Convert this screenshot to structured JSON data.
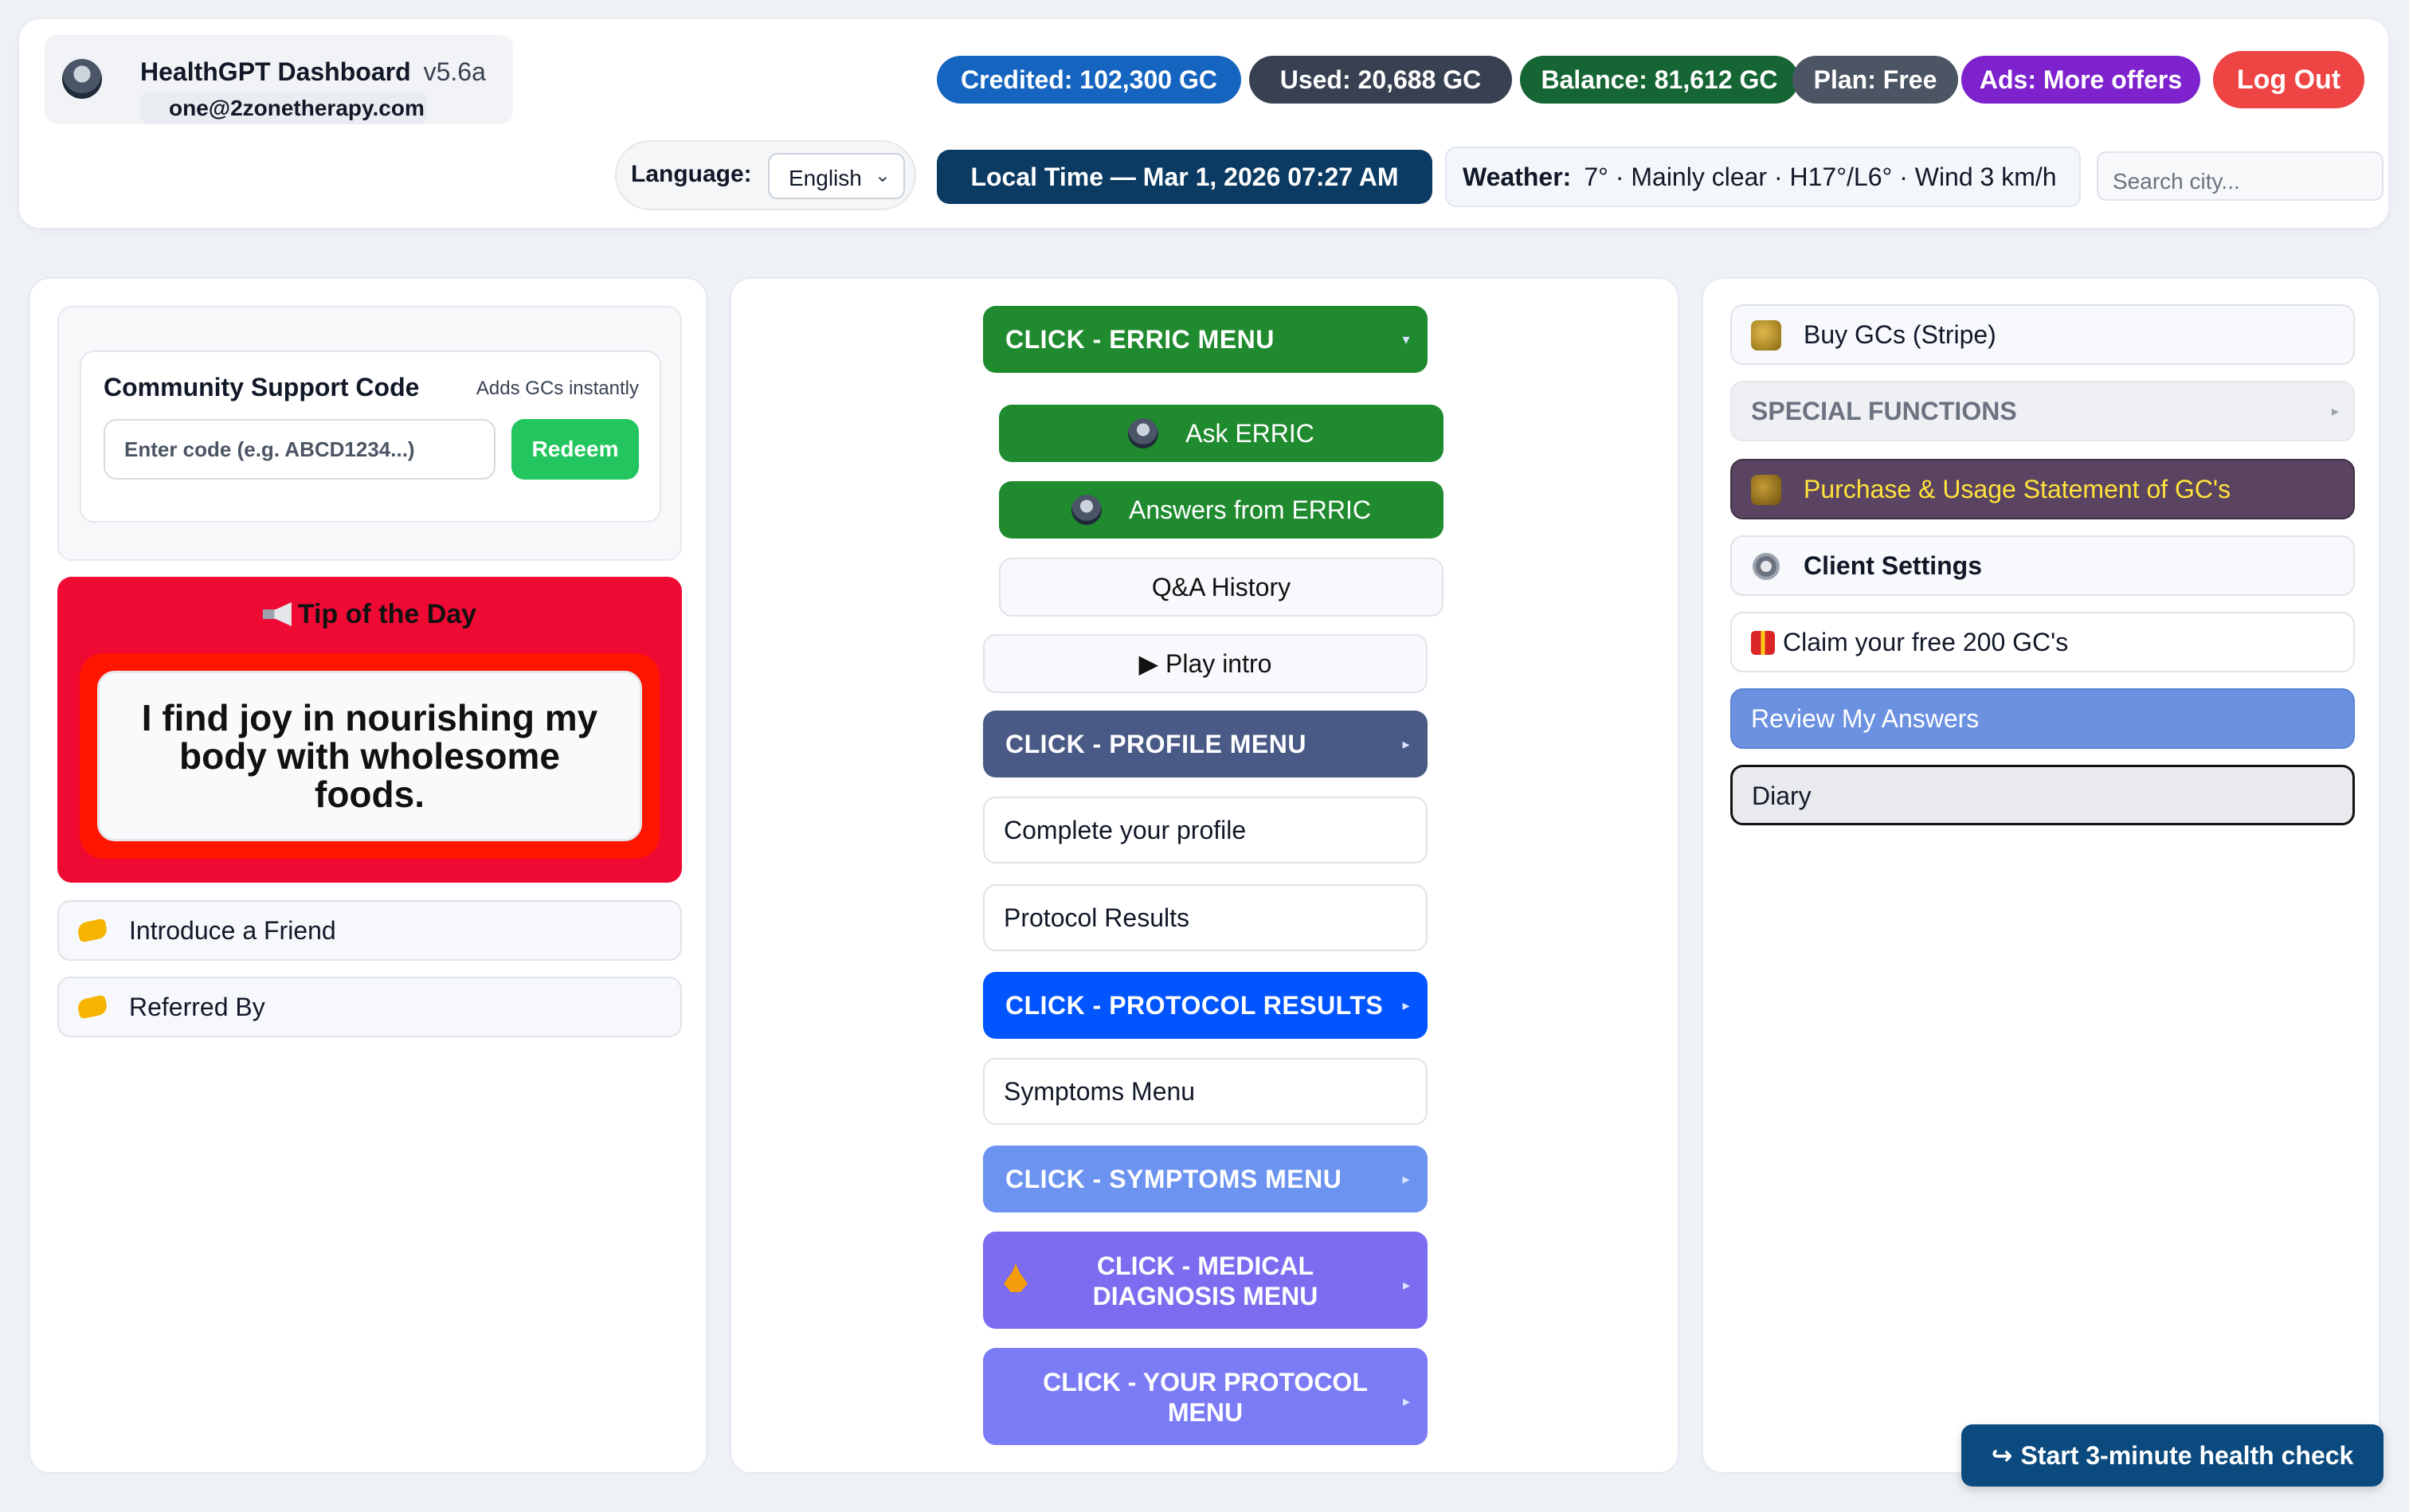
{
  "header": {
    "app_title": "HealthGPT Dashboard",
    "version": "v5.6a",
    "email": "one@2zonetherapy.com",
    "credited": "Credited: 102,300 GC",
    "used": "Used: 20,688 GC",
    "balance": "Balance: 81,612 GC",
    "plan": "Plan: Free",
    "ads": "Ads: More offers",
    "logout": "Log Out",
    "language_label": "Language:",
    "language_value": "English",
    "local_time": "Local Time — Mar 1, 2026 07:27 AM",
    "weather_label": "Weather:",
    "weather_value": "7° · Mainly clear · H17°/L6° · Wind 3 km/h",
    "city_placeholder": "Search city..."
  },
  "left": {
    "support_title": "Community Support Code",
    "support_note": "Adds GCs instantly",
    "code_placeholder": "Enter code (e.g. ABCD1234...)",
    "redeem": "Redeem",
    "tip_title": "Tip of the Day",
    "tip_text": "I find joy in nourishing my body with wholesome foods.",
    "introduce": "Introduce a Friend",
    "referred": "Referred By"
  },
  "middle": {
    "erric_menu": "CLICK - ERRIC MENU",
    "ask": "Ask ERRIC",
    "answers": "Answers from ERRIC",
    "qa_history": "Q&A History",
    "play_intro": "▶ Play intro",
    "profile_menu": "CLICK - PROFILE MENU",
    "complete_profile": "Complete your profile",
    "protocol_results_link": "Protocol Results",
    "protocol_results_menu": "CLICK - PROTOCOL RESULTS",
    "symptoms_link": "Symptoms Menu",
    "symptoms_menu": "CLICK - SYMPTOMS MENU",
    "medical_line1": "CLICK - MEDICAL",
    "medical_line2": "DIAGNOSIS MENU",
    "your_protocol_line1": "CLICK - YOUR PROTOCOL",
    "your_protocol_line2": "MENU"
  },
  "right": {
    "buy": "Buy GCs (Stripe)",
    "special": "SPECIAL FUNCTIONS",
    "purchase": "Purchase & Usage Statement of GC's",
    "settings": "Client Settings",
    "claim": "Claim your free 200 GC's",
    "review": "Review My Answers",
    "diary": "Diary"
  },
  "footer": {
    "health_check": "Start 3-minute health check"
  },
  "icons": {
    "avatar": "avatar-icon",
    "megaphone": "megaphone-icon",
    "handshake": "handshake-icon",
    "coin": "coin-icon",
    "gear": "gear-icon",
    "gift": "gift-icon",
    "yoga": "meditation-icon",
    "arrow": "arrow-icon",
    "triangle": "triangle-right-icon"
  },
  "colors": {
    "erric_green": "#1f8a2e",
    "profile_slate": "#4a5a86",
    "protocol_blue": "#0055ff",
    "symptoms_blue": "#6c93ef",
    "medical_purple": "#7b6cf0",
    "tip_red": "#ef0a34",
    "logout_red": "#ef4444"
  }
}
